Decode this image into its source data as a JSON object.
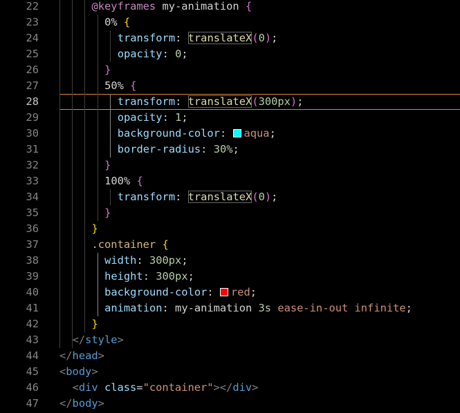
{
  "editor": {
    "language": "html",
    "active_line": 28,
    "colors": {
      "background": "#000000",
      "cursor_line_border": "#e4873b",
      "line_number": "#858585",
      "selector": "#d7ba7d",
      "property": "#9cdcfe",
      "number": "#b5cea8",
      "string": "#ce9178",
      "tag": "#569cd6"
    },
    "lines": [
      {
        "n": "22",
        "indent": 7,
        "tokens": [
          {
            "c": "t-at",
            "t": "@keyframes"
          },
          {
            "c": "t-kf",
            "t": " my-animation "
          },
          {
            "c": "t-brace2",
            "t": "{"
          }
        ]
      },
      {
        "n": "23",
        "indent": 9,
        "tokens": [
          {
            "c": "t-pct",
            "t": "0% "
          },
          {
            "c": "t-brace1",
            "t": "{"
          }
        ]
      },
      {
        "n": "24",
        "indent": 11,
        "tokens": [
          {
            "c": "t-prop",
            "t": "transform"
          },
          {
            "c": "t-punct",
            "t": ": "
          },
          {
            "c": "t-fn",
            "t": "translateX"
          },
          {
            "c": "t-brace2",
            "t": "("
          },
          {
            "c": "t-num",
            "t": "0"
          },
          {
            "c": "t-brace2",
            "t": ")"
          },
          {
            "c": "t-punct",
            "t": ";"
          }
        ]
      },
      {
        "n": "25",
        "indent": 11,
        "tokens": [
          {
            "c": "t-prop",
            "t": "opacity"
          },
          {
            "c": "t-punct",
            "t": ": "
          },
          {
            "c": "t-num",
            "t": "0"
          },
          {
            "c": "t-punct",
            "t": ";"
          }
        ]
      },
      {
        "n": "26",
        "indent": 9,
        "tokens": [
          {
            "c": "t-brace2",
            "t": "}"
          }
        ]
      },
      {
        "n": "27",
        "indent": 9,
        "tokens": [
          {
            "c": "t-pct",
            "t": "50% "
          },
          {
            "c": "t-brace2",
            "t": "{"
          }
        ]
      },
      {
        "n": "28",
        "indent": 11,
        "tokens": [
          {
            "c": "t-prop",
            "t": "transform"
          },
          {
            "c": "t-punct",
            "t": ": "
          },
          {
            "c": "t-fn",
            "t": "translateX"
          },
          {
            "c": "t-brace2",
            "t": "("
          },
          {
            "c": "t-num",
            "t": "300px"
          },
          {
            "c": "t-brace2",
            "t": ")"
          },
          {
            "c": "t-punct",
            "t": ";"
          }
        ]
      },
      {
        "n": "29",
        "indent": 11,
        "tokens": [
          {
            "c": "t-prop",
            "t": "opacity"
          },
          {
            "c": "t-punct",
            "t": ": "
          },
          {
            "c": "t-num",
            "t": "1"
          },
          {
            "c": "t-punct",
            "t": ";"
          }
        ]
      },
      {
        "n": "30",
        "indent": 11,
        "tokens": [
          {
            "c": "t-prop",
            "t": "background-color"
          },
          {
            "c": "t-punct",
            "t": ": "
          },
          {
            "c": "swatch",
            "t": "",
            "color": "#00ffff"
          },
          {
            "c": "t-val",
            "t": "aqua"
          },
          {
            "c": "t-punct",
            "t": ";"
          }
        ]
      },
      {
        "n": "31",
        "indent": 11,
        "tokens": [
          {
            "c": "t-prop",
            "t": "border-radius"
          },
          {
            "c": "t-punct",
            "t": ": "
          },
          {
            "c": "t-num",
            "t": "30%"
          },
          {
            "c": "t-punct",
            "t": ";"
          }
        ]
      },
      {
        "n": "32",
        "indent": 9,
        "tokens": [
          {
            "c": "t-brace2",
            "t": "}"
          }
        ]
      },
      {
        "n": "33",
        "indent": 9,
        "tokens": [
          {
            "c": "t-pct",
            "t": "100% "
          },
          {
            "c": "t-brace2",
            "t": "{"
          }
        ]
      },
      {
        "n": "34",
        "indent": 11,
        "tokens": [
          {
            "c": "t-prop",
            "t": "transform"
          },
          {
            "c": "t-punct",
            "t": ": "
          },
          {
            "c": "t-fn",
            "t": "translateX"
          },
          {
            "c": "t-brace2",
            "t": "("
          },
          {
            "c": "t-num",
            "t": "0"
          },
          {
            "c": "t-brace2",
            "t": ")"
          },
          {
            "c": "t-punct",
            "t": ";"
          }
        ]
      },
      {
        "n": "35",
        "indent": 9,
        "tokens": [
          {
            "c": "t-brace2",
            "t": "}"
          }
        ]
      },
      {
        "n": "36",
        "indent": 7,
        "tokens": [
          {
            "c": "t-brace1",
            "t": "}"
          }
        ]
      },
      {
        "n": "37",
        "indent": 7,
        "tokens": [
          {
            "c": "t-sel",
            "t": ".container "
          },
          {
            "c": "t-brace1",
            "t": "{"
          }
        ]
      },
      {
        "n": "38",
        "indent": 9,
        "tokens": [
          {
            "c": "t-prop",
            "t": "width"
          },
          {
            "c": "t-punct",
            "t": ": "
          },
          {
            "c": "t-num",
            "t": "300px"
          },
          {
            "c": "t-punct",
            "t": ";"
          }
        ]
      },
      {
        "n": "39",
        "indent": 9,
        "tokens": [
          {
            "c": "t-prop",
            "t": "height"
          },
          {
            "c": "t-punct",
            "t": ": "
          },
          {
            "c": "t-num",
            "t": "300px"
          },
          {
            "c": "t-punct",
            "t": ";"
          }
        ]
      },
      {
        "n": "40",
        "indent": 9,
        "tokens": [
          {
            "c": "t-prop",
            "t": "background-color"
          },
          {
            "c": "t-punct",
            "t": ": "
          },
          {
            "c": "swatch",
            "t": "",
            "color": "#ff0000"
          },
          {
            "c": "t-val",
            "t": "red"
          },
          {
            "c": "t-punct",
            "t": ";"
          }
        ]
      },
      {
        "n": "41",
        "indent": 9,
        "tokens": [
          {
            "c": "t-prop",
            "t": "animation"
          },
          {
            "c": "t-punct",
            "t": ": "
          },
          {
            "c": "t-kf",
            "t": "my-animation "
          },
          {
            "c": "t-num",
            "t": "3s"
          },
          {
            "c": "t-val",
            "t": " ease-in-out infinite"
          },
          {
            "c": "t-punct",
            "t": ";"
          }
        ]
      },
      {
        "n": "42",
        "indent": 7,
        "tokens": [
          {
            "c": "t-brace1",
            "t": "}"
          }
        ]
      },
      {
        "n": "43",
        "indent": 4,
        "tokens": [
          {
            "c": "t-tagb",
            "t": "</"
          },
          {
            "c": "t-tag",
            "t": "style"
          },
          {
            "c": "t-tagb",
            "t": ">"
          }
        ]
      },
      {
        "n": "44",
        "indent": 2,
        "tokens": [
          {
            "c": "t-tagb",
            "t": "</"
          },
          {
            "c": "t-tag",
            "t": "head"
          },
          {
            "c": "t-tagb",
            "t": ">"
          }
        ]
      },
      {
        "n": "45",
        "indent": 2,
        "tokens": [
          {
            "c": "t-tagb",
            "t": "<"
          },
          {
            "c": "t-tag",
            "t": "body"
          },
          {
            "c": "t-tagb",
            "t": ">"
          }
        ]
      },
      {
        "n": "46",
        "indent": 4,
        "tokens": [
          {
            "c": "t-tagb",
            "t": "<"
          },
          {
            "c": "t-tag",
            "t": "div"
          },
          {
            "c": "t-attr",
            "t": " class"
          },
          {
            "c": "t-punct",
            "t": "="
          },
          {
            "c": "t-str",
            "t": "\"container\""
          },
          {
            "c": "t-tagb",
            "t": "></"
          },
          {
            "c": "t-tag",
            "t": "div"
          },
          {
            "c": "t-tagb",
            "t": ">"
          }
        ]
      },
      {
        "n": "47",
        "indent": 2,
        "tokens": [
          {
            "c": "t-tagb",
            "t": "</"
          },
          {
            "c": "t-tag",
            "t": "body"
          },
          {
            "c": "t-tagb",
            "t": ">"
          }
        ]
      }
    ]
  }
}
